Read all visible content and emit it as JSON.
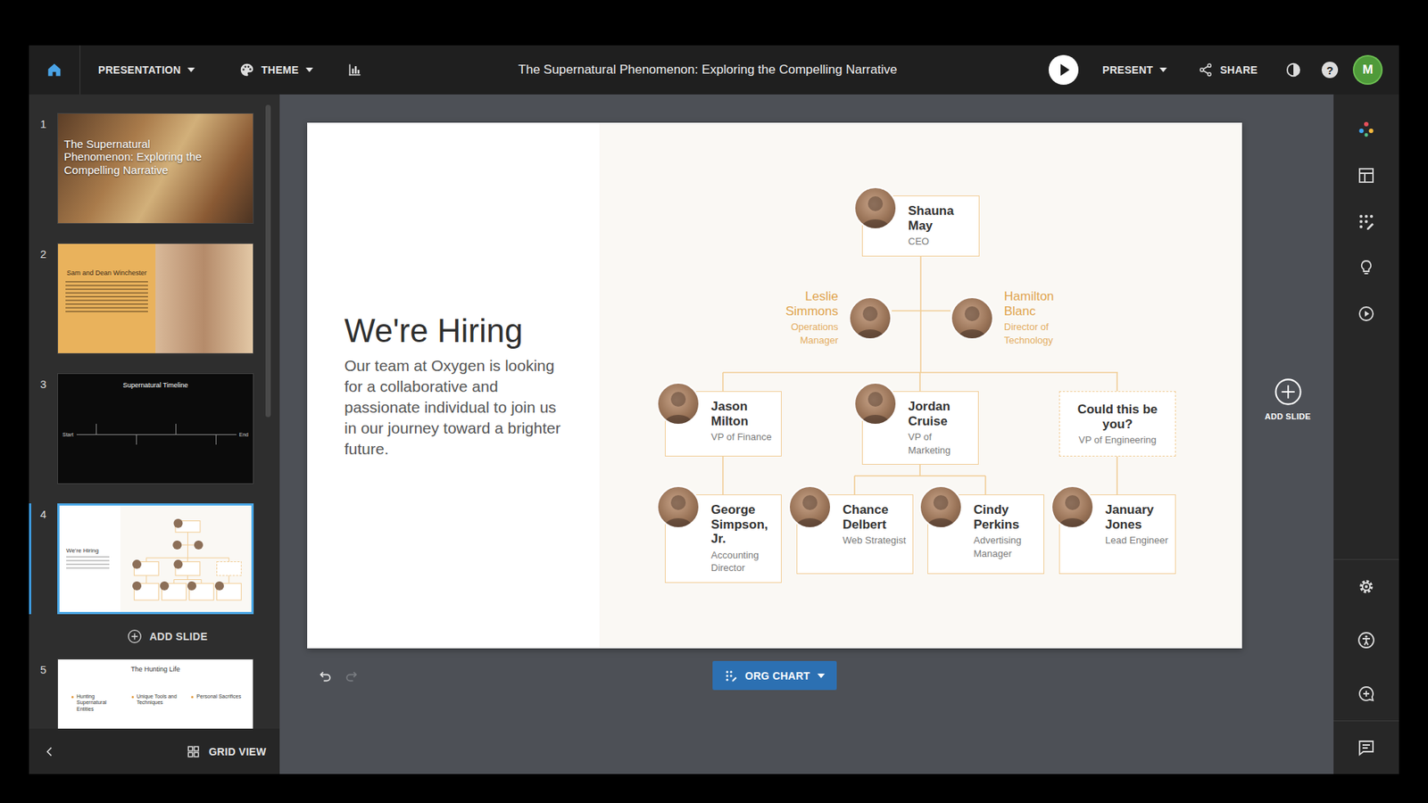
{
  "window": {
    "title": "The Supernatural Phenomenon: Exploring the Compelling Narrative"
  },
  "toolbar": {
    "presentation": "PRESENTATION",
    "theme": "THEME",
    "present": "PRESENT",
    "share": "SHARE",
    "help": "?",
    "user_initial": "M"
  },
  "sidebar": {
    "add_slide": "ADD SLIDE",
    "grid_view": "GRID VIEW"
  },
  "slides": [
    {
      "number": "1",
      "kind": "cover",
      "title": "The Supernatural Phenomenon: Exploring the Compelling Narrative",
      "selected": false
    },
    {
      "number": "2",
      "kind": "split",
      "title": "Sam and Dean Winchester",
      "selected": false
    },
    {
      "number": "3",
      "kind": "timeline",
      "title": "Supernatural Timeline",
      "start": "Start",
      "end": "End",
      "selected": false
    },
    {
      "number": "4",
      "kind": "hiring",
      "title": "We're Hiring",
      "selected": true
    },
    {
      "number": "5",
      "kind": "bullets",
      "title": "The Hunting Life",
      "bullets": [
        "Hunting Supernatural Entities",
        "Unique Tools and Techniques",
        "Personal Sacrifices"
      ],
      "selected": false
    }
  ],
  "slide": {
    "heading": "We're Hiring",
    "body": "Our team at Oxygen is looking for a collaborative and passionate individual to join us in our journey toward a brighter future."
  },
  "org_chart": {
    "nodes": [
      {
        "name": "Shauna May",
        "role": "CEO",
        "kind": "card"
      },
      {
        "name": "Leslie Simmons",
        "role": "Operations Manager",
        "kind": "side-left"
      },
      {
        "name": "Hamilton Blanc",
        "role": "Director of Technology",
        "kind": "side-right"
      },
      {
        "name": "Jason Milton",
        "role": "VP of Finance",
        "kind": "card"
      },
      {
        "name": "Jordan Cruise",
        "role": "VP of Marketing",
        "kind": "card"
      },
      {
        "name": "Could this be you?",
        "role": "VP of Engineering",
        "kind": "open"
      },
      {
        "name": "George Simpson, Jr.",
        "role": "Accounting Director",
        "kind": "card"
      },
      {
        "name": "Chance Delbert",
        "role": "Web Strategist",
        "kind": "card"
      },
      {
        "name": "Cindy Perkins",
        "role": "Advertising Manager",
        "kind": "card"
      },
      {
        "name": "January Jones",
        "role": "Lead Engineer",
        "kind": "card"
      }
    ]
  },
  "canvas": {
    "add_slide": "ADD SLIDE",
    "layout_button": "ORG CHART"
  }
}
